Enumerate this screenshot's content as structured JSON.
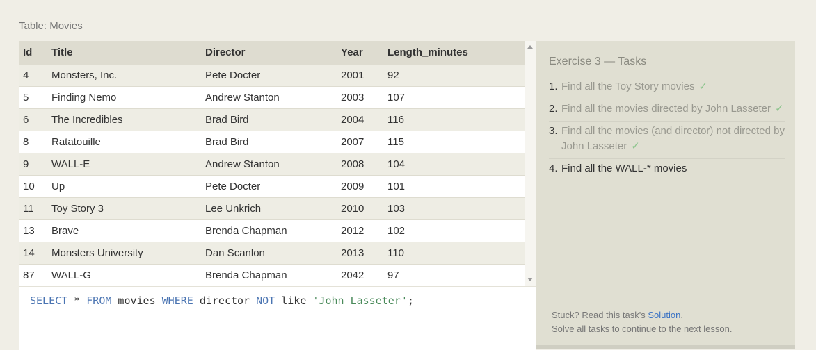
{
  "table_caption": "Table: Movies",
  "columns": [
    "Id",
    "Title",
    "Director",
    "Year",
    "Length_minutes"
  ],
  "rows": [
    [
      "4",
      "Monsters, Inc.",
      "Pete Docter",
      "2001",
      "92"
    ],
    [
      "5",
      "Finding Nemo",
      "Andrew Stanton",
      "2003",
      "107"
    ],
    [
      "6",
      "The Incredibles",
      "Brad Bird",
      "2004",
      "116"
    ],
    [
      "8",
      "Ratatouille",
      "Brad Bird",
      "2007",
      "115"
    ],
    [
      "9",
      "WALL-E",
      "Andrew Stanton",
      "2008",
      "104"
    ],
    [
      "10",
      "Up",
      "Pete Docter",
      "2009",
      "101"
    ],
    [
      "11",
      "Toy Story 3",
      "Lee Unkrich",
      "2010",
      "103"
    ],
    [
      "13",
      "Brave",
      "Brenda Chapman",
      "2012",
      "102"
    ],
    [
      "14",
      "Monsters University",
      "Dan Scanlon",
      "2013",
      "110"
    ],
    [
      "87",
      "WALL-G",
      "Brenda Chapman",
      "2042",
      "97"
    ]
  ],
  "query": {
    "tokens": [
      {
        "t": "SELECT",
        "k": "kw"
      },
      {
        "t": " * ",
        "k": ""
      },
      {
        "t": "FROM",
        "k": "kw"
      },
      {
        "t": " movies ",
        "k": ""
      },
      {
        "t": "WHERE",
        "k": "kw"
      },
      {
        "t": " director ",
        "k": ""
      },
      {
        "t": "NOT",
        "k": "kw"
      },
      {
        "t": " like ",
        "k": ""
      },
      {
        "t": "'John Lasseter",
        "k": "str"
      },
      {
        "t": "|",
        "k": "caret"
      },
      {
        "t": "'",
        "k": "str"
      },
      {
        "t": ";",
        "k": ""
      }
    ]
  },
  "tasks": {
    "title": "Exercise 3 — Tasks",
    "items": [
      {
        "num": "1.",
        "text": "Find all the Toy Story movies",
        "done": true
      },
      {
        "num": "2.",
        "text": "Find all the movies directed by John Lasseter",
        "done": true
      },
      {
        "num": "3.",
        "text": "Find all the movies (and director) not directed by John Lasseter",
        "done": true
      },
      {
        "num": "4.",
        "text": "Find all the WALL-* movies",
        "done": false
      }
    ],
    "check_mark": "✓"
  },
  "help": {
    "stuck_prefix": "Stuck? Read this task's ",
    "solution_link": "Solution",
    "stuck_suffix": ".",
    "continue_text": "Solve all tasks to continue to the next lesson."
  },
  "colors": {
    "keyword": "#4a74b2",
    "string": "#4a8a5a",
    "check": "#8cc48c",
    "link": "#3a72c4"
  }
}
